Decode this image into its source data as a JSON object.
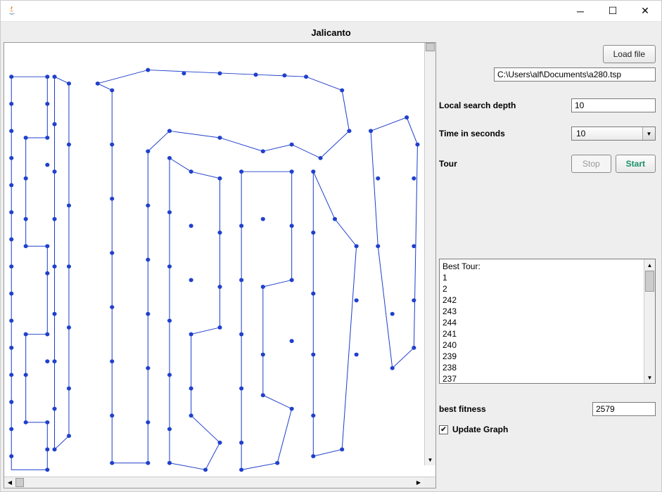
{
  "window": {
    "title": ""
  },
  "app": {
    "title": "Jalicanto"
  },
  "buttons": {
    "load_file": "Load file",
    "stop": "Stop",
    "start": "Start"
  },
  "fields": {
    "file_path": "C:\\Users\\alf\\Documents\\a280.tsp",
    "local_search_depth_label": "Local search depth",
    "local_search_depth_value": "10",
    "time_label": "Time in seconds",
    "time_value": "10",
    "tour_label": "Tour",
    "best_fitness_label": "best fitness",
    "best_fitness_value": "2579"
  },
  "best_tour_text": "Best Tour:\n1\n2\n242\n243\n244\n241\n240\n239\n238\n237",
  "update_graph": {
    "label": "Update Graph",
    "checked": true
  },
  "colors": {
    "graph": "#2040cc"
  }
}
